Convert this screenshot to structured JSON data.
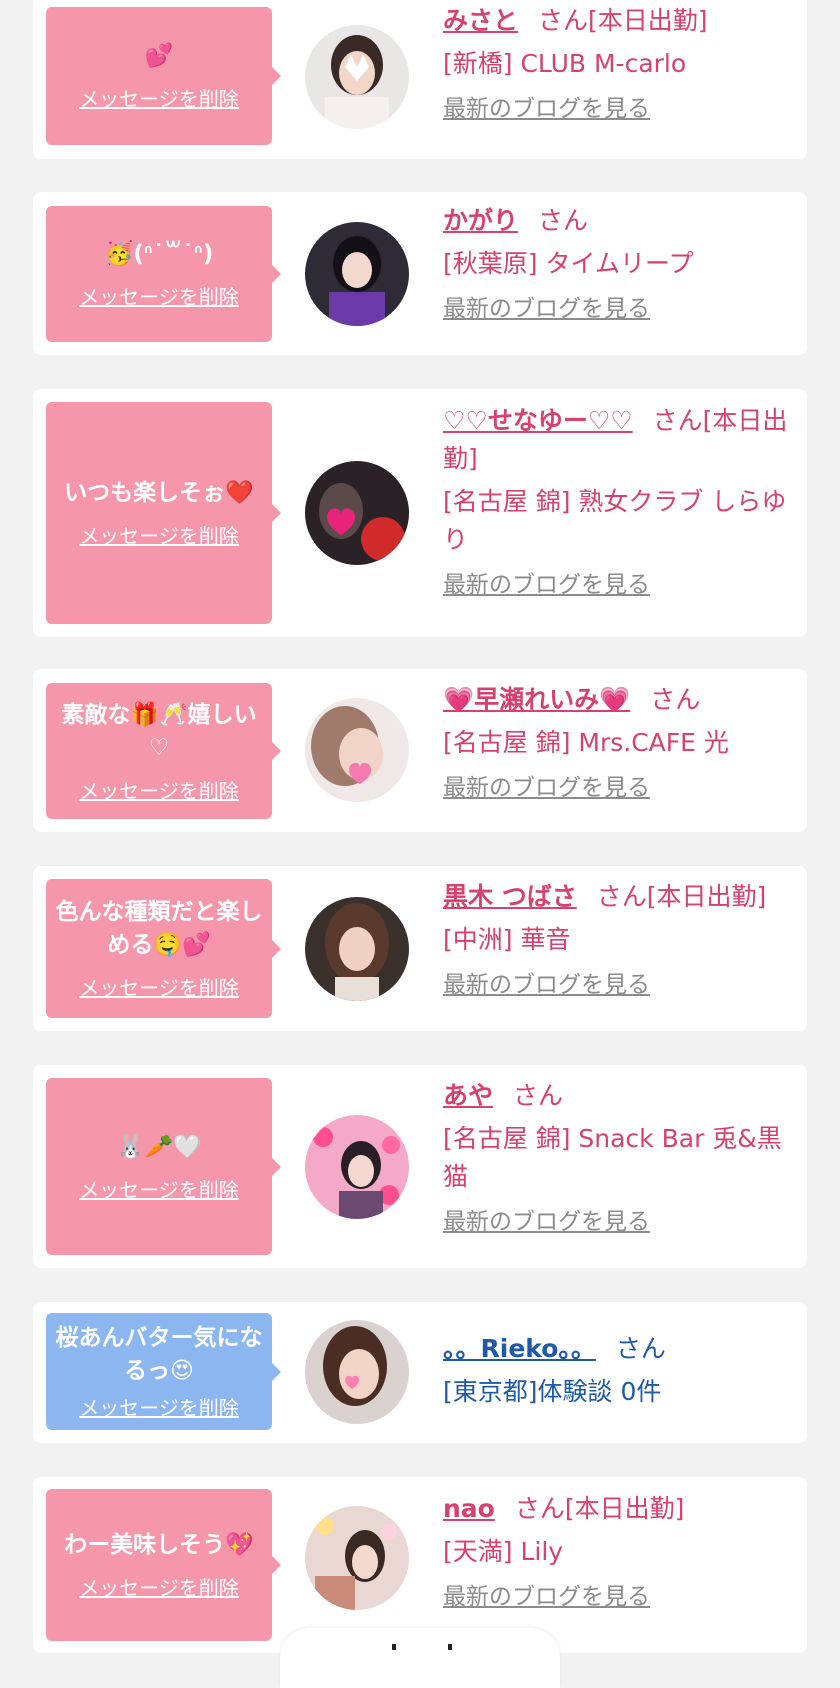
{
  "common": {
    "delete_label": "メッセージを削除",
    "blog_label": "最新のブログを見る",
    "san_label": "さん"
  },
  "cards": [
    {
      "message": "💕",
      "name": "みさと",
      "status": "[本日出勤]",
      "shop": "[新橋] CLUB M-carlo",
      "has_blog": true,
      "bubble_color": "#f596aa"
    },
    {
      "message": "🥳(ᐢ˙꒳˙ᐢ)",
      "name": "かがり",
      "status": "",
      "shop": "[秋葉原] タイムリープ",
      "has_blog": true,
      "bubble_color": "#f596aa"
    },
    {
      "message": "いつも楽しそぉ❤️",
      "name": "♡♡せなゆー♡♡",
      "status": "[本日出勤]",
      "shop": "[名古屋 錦] 熟女クラブ しらゆり",
      "has_blog": true,
      "bubble_color": "#f596aa"
    },
    {
      "message": "素敵な🎁🥂嬉しい♡",
      "name": "💗早瀬れいみ💗",
      "status": "",
      "shop": "[名古屋 錦] Mrs.CAFE 光",
      "has_blog": true,
      "bubble_color": "#f596aa"
    },
    {
      "message": "色んな種類だと楽しめる🤤💕",
      "name": "黒木 つばさ",
      "status": "[本日出勤]",
      "shop": "[中洲] 華音",
      "has_blog": true,
      "bubble_color": "#f596aa"
    },
    {
      "message": "🐰🥕🤍",
      "name": "あや",
      "status": "",
      "shop": "[名古屋 錦] Snack Bar 兎&黒猫",
      "has_blog": true,
      "bubble_color": "#f596aa"
    },
    {
      "message": "桜あんバター気になるっ😍",
      "name": "。。Rieko。。",
      "status": "",
      "shop": "[東京都]体験談 0件",
      "has_blog": false,
      "bubble_color": "#8cb6ef"
    },
    {
      "message": "わー美味しそう💖",
      "name": "nao",
      "status": "[本日出勤]",
      "shop": "[天満] Lily",
      "has_blog": true,
      "bubble_color": "#f596aa"
    }
  ]
}
